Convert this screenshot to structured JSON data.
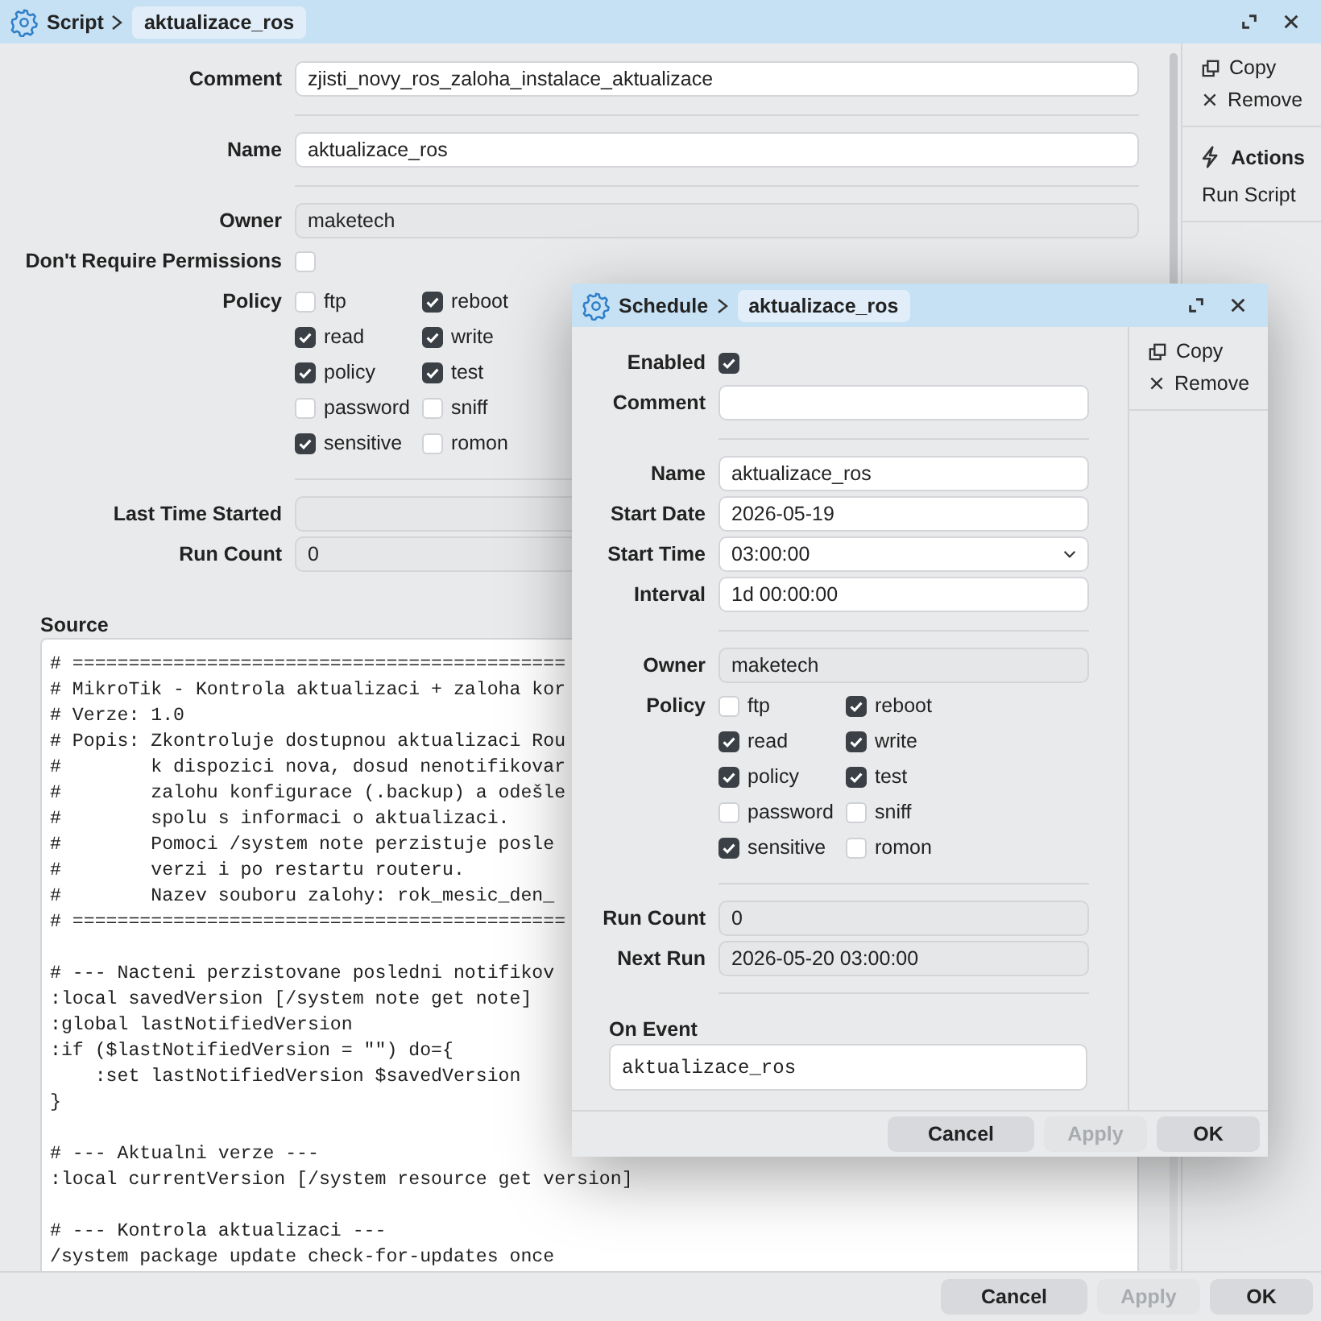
{
  "script_window": {
    "title": "Script",
    "crumb": "aktualizace_ros",
    "groups": [
      [
        {
          "kind": "text",
          "label": "Comment",
          "value": "zjisti_novy_ros_zaloha_instalace_aktualizace"
        }
      ],
      [
        {
          "kind": "text",
          "label": "Name",
          "value": "aktualizace_ros"
        }
      ],
      [
        {
          "kind": "readonly",
          "label": "Owner",
          "value": "maketech"
        },
        {
          "kind": "checkbox",
          "label": "Don't Require Permissions",
          "checked": false
        },
        {
          "kind": "policy",
          "label": "Policy",
          "options": [
            {
              "label": "ftp",
              "checked": false
            },
            {
              "label": "reboot",
              "checked": true
            },
            {
              "label": "read",
              "checked": true
            },
            {
              "label": "write",
              "checked": true
            },
            {
              "label": "policy",
              "checked": true
            },
            {
              "label": "test",
              "checked": true
            },
            {
              "label": "password",
              "checked": false
            },
            {
              "label": "sniff",
              "checked": false
            },
            {
              "label": "sensitive",
              "checked": true
            },
            {
              "label": "romon",
              "checked": false
            }
          ]
        }
      ],
      [
        {
          "kind": "readonly",
          "label": "Last Time Started"
        },
        {
          "kind": "readonly",
          "label": "Run Count",
          "value": "0"
        }
      ]
    ],
    "source_label": "Source",
    "source": "# ============================================\n# MikroTik - Kontrola aktualizaci + zaloha kor\n# Verze: 1.0\n# Popis: Zkontroluje dostupnou aktualizaci Rou\n#        k dispozici nova, dosud nenotifikovar\n#        zalohu konfigurace (.backup) a odešle\n#        spolu s informaci o aktualizaci.\n#        Pomoci /system note perzistuje posle\n#        verzi i po restartu routeru.\n#        Nazev souboru zalohy: rok_mesic_den_\n# ============================================\n\n# --- Nacteni perzistovane posledni notifikov\n:local savedVersion [/system note get note]\n:global lastNotifiedVersion\n:if ($lastNotifiedVersion = \"\") do={\n    :set lastNotifiedVersion $savedVersion\n}\n\n# --- Aktualni verze ---\n:local currentVersion [/system resource get version]\n\n# --- Kontrola aktualizaci ---\n/system package update check-for-updates once",
    "sidebar": [
      {
        "items": [
          "Copy",
          "Remove"
        ]
      },
      {
        "heading": "Actions",
        "items": [
          "Run Script"
        ]
      }
    ],
    "buttons": [
      {
        "label": "Cancel",
        "disabled": false
      },
      {
        "label": "Apply",
        "disabled": true
      },
      {
        "label": "OK",
        "disabled": false
      }
    ]
  },
  "schedule_window": {
    "title": "Schedule",
    "crumb": "aktualizace_ros",
    "groups": [
      [
        {
          "kind": "checkbox",
          "label": "Enabled",
          "checked": true
        },
        {
          "kind": "text",
          "label": "Comment"
        }
      ],
      [
        {
          "kind": "text",
          "label": "Name",
          "value": "aktualizace_ros"
        },
        {
          "kind": "text",
          "label": "Start Date",
          "value": "2026-05-19"
        },
        {
          "kind": "select",
          "label": "Start Time",
          "value": "03:00:00"
        },
        {
          "kind": "text",
          "label": "Interval",
          "value": "1d 00:00:00"
        }
      ],
      [
        {
          "kind": "readonly",
          "label": "Owner",
          "value": "maketech"
        },
        {
          "kind": "policy",
          "label": "Policy",
          "options": [
            {
              "label": "ftp",
              "checked": false
            },
            {
              "label": "reboot",
              "checked": true
            },
            {
              "label": "read",
              "checked": true
            },
            {
              "label": "write",
              "checked": true
            },
            {
              "label": "policy",
              "checked": true
            },
            {
              "label": "test",
              "checked": true
            },
            {
              "label": "password",
              "checked": false
            },
            {
              "label": "sniff",
              "checked": false
            },
            {
              "label": "sensitive",
              "checked": true
            },
            {
              "label": "romon",
              "checked": false
            }
          ]
        }
      ],
      [
        {
          "kind": "readonly",
          "label": "Run Count",
          "value": "0"
        },
        {
          "kind": "readonly",
          "label": "Next Run",
          "value": "2026-05-20 03:00:00"
        }
      ]
    ],
    "on_event_label": "On Event",
    "on_event": "aktualizace_ros",
    "sidebar": [
      {
        "items": [
          "Copy",
          "Remove"
        ]
      }
    ],
    "buttons": [
      {
        "label": "Cancel",
        "disabled": false
      },
      {
        "label": "Apply",
        "disabled": true
      },
      {
        "label": "OK",
        "disabled": false
      }
    ]
  }
}
